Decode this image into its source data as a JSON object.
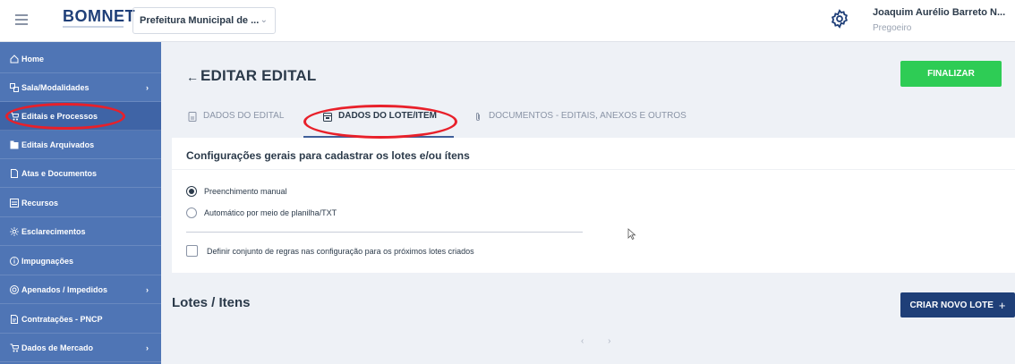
{
  "header": {
    "logo": "BOMNET",
    "org_select": "Prefeitura Municipal de ...",
    "user_name": "Joaquim Aurélio Barreto N...",
    "user_role": "Pregoeiro"
  },
  "sidebar": {
    "items": [
      {
        "label": "Home",
        "icon": "home-icon",
        "caret": ""
      },
      {
        "label": "Sala/Modalidades",
        "icon": "rooms-icon",
        "caret": "›"
      },
      {
        "label": "Editais e Processos",
        "icon": "cart-icon",
        "caret": ""
      },
      {
        "label": "Editais Arquivados",
        "icon": "archive-icon",
        "caret": ""
      },
      {
        "label": "Atas e Documentos",
        "icon": "document-icon",
        "caret": ""
      },
      {
        "label": "Recursos",
        "icon": "list-icon",
        "caret": ""
      },
      {
        "label": "Esclarecimentos",
        "icon": "sun-icon",
        "caret": ""
      },
      {
        "label": "Impugnações",
        "icon": "info-icon",
        "caret": ""
      },
      {
        "label": "Apenados / Impedidos",
        "icon": "target-icon",
        "caret": "›"
      },
      {
        "label": "Contratações - PNCP",
        "icon": "contract-icon",
        "caret": ""
      },
      {
        "label": "Dados de Mercado",
        "icon": "cart-icon",
        "caret": "›"
      }
    ]
  },
  "main": {
    "back_arrow": "←",
    "title": "EDITAR EDITAL",
    "finalizar_label": "FINALIZAR",
    "tabs": [
      {
        "label": "DADOS DO EDITAL",
        "icon": "document-icon"
      },
      {
        "label": "DADOS DO LOTE/ITEM",
        "icon": "calendar-icon"
      },
      {
        "label": "DOCUMENTOS - EDITAIS, ANEXOS E OUTROS",
        "icon": "paperclip-icon"
      }
    ],
    "config": {
      "title": "Configurações gerais para cadastrar os lotes e/ou ítens",
      "option_manual": "Preenchimento manual",
      "option_auto": "Automático por meio de planilha/TXT",
      "selected": "Preenchimento manual",
      "rules_checkbox_label": "Definir conjunto de regras nas configuração para os próximos lotes criados"
    },
    "lotes": {
      "title": "Lotes / Itens",
      "criar_label": "CRIAR NOVO LOTE",
      "criar_icon": "+",
      "pager": "‹ ›"
    }
  },
  "colors": {
    "sidebar_bg": "#4f75b5",
    "primary_dark": "#1f3f78",
    "success": "#2ecc55",
    "annotation_red": "#e8202a"
  }
}
